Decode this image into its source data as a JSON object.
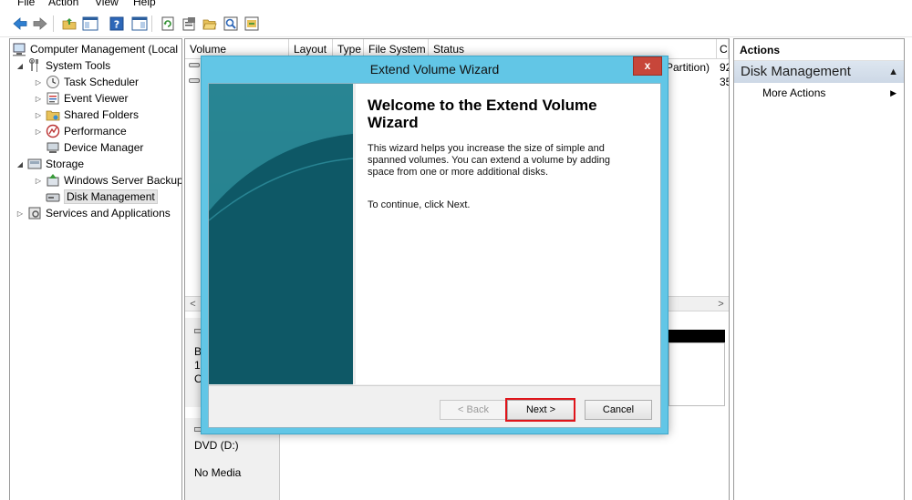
{
  "menu": {
    "items": [
      "File",
      "Action",
      "View",
      "Help"
    ]
  },
  "toolbar": {
    "buttons": [
      "back-icon",
      "forward-icon",
      "up-folder-icon",
      "show-hide-tree-icon",
      "help-icon",
      "show-hide-action-pane-icon",
      "refresh-icon",
      "properties-icon",
      "open-icon",
      "search-icon",
      "export-icon"
    ]
  },
  "tree": {
    "root": "Computer Management (Local",
    "system_tools": "System Tools",
    "task_scheduler": "Task Scheduler",
    "event_viewer": "Event Viewer",
    "shared_folders": "Shared Folders",
    "performance": "Performance",
    "device_manager": "Device Manager",
    "storage": "Storage",
    "windows_server_backup": "Windows Server Backup",
    "disk_management": "Disk Management",
    "services_apps": "Services and Applications"
  },
  "center": {
    "columns": {
      "volume": "Volume",
      "layout": "Layout",
      "type": "Type",
      "file_system": "File System",
      "status": "Status",
      "capacity_partial": "C"
    },
    "partial_cells": {
      "status_tail": "Partition)",
      "cap_1": "92",
      "cap_2": "35"
    },
    "disk_partial": {
      "line1": "B",
      "line2": "1",
      "line3": "O"
    },
    "dvd": {
      "name": "DVD (D:)",
      "media": "No Media"
    }
  },
  "actions": {
    "header": "Actions",
    "section": "Disk Management",
    "more": "More Actions"
  },
  "wizard": {
    "title": "Extend Volume Wizard",
    "close": "x",
    "heading": "Welcome to the Extend Volume Wizard",
    "body": "This wizard helps you increase the size of simple and spanned volumes. You can extend a volume  by adding space from one or more additional disks.",
    "continue": "To continue, click Next.",
    "back_label": "< Back",
    "next_label": "Next >",
    "cancel_label": "Cancel"
  },
  "colors": {
    "dialog_frame": "#62c6e6",
    "close_button": "#c7463a",
    "banner": "#11606e",
    "highlight": "#e0141a",
    "actions_section": "#d6e0ec"
  }
}
